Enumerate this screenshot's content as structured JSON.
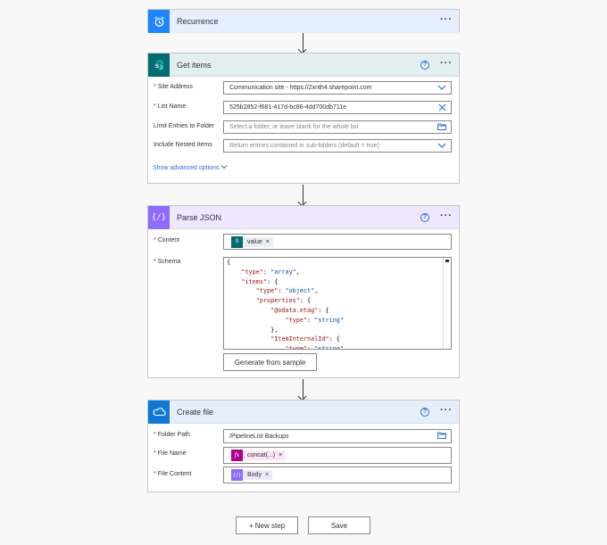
{
  "recurrence": {
    "title": "Recurrence"
  },
  "get_items": {
    "title": "Get items",
    "fields": [
      {
        "label": "Site Address",
        "required": true,
        "value": "Communication site - https://2xnth4.sharepoint.com"
      },
      {
        "label": "List Name",
        "required": true,
        "value": "525b2852-f681-417d-bc86-4dd700db711e"
      },
      {
        "label": "Limit Entries to Folder",
        "required": false,
        "placeholder": "Select a folder, or leave blank for the whole list"
      },
      {
        "label": "Include Nested Items",
        "required": false,
        "placeholder": "Return entries contained in sub-folders (default = true)"
      }
    ],
    "advanced_link": "Show advanced options"
  },
  "parse_json": {
    "title": "Parse JSON",
    "content_label": "Content",
    "content_token": "value",
    "schema_label": "Schema",
    "schema_lines": [
      "{",
      "    \"type\": \"array\",",
      "    \"items\": {",
      "        \"type\": \"object\",",
      "        \"properties\": {",
      "            \"@odata.etag\": {",
      "                \"type\": \"string\"",
      "            },",
      "            \"ItemInternalId\": {",
      "                \"type\": \"string\""
    ],
    "generate_button": "Generate from sample"
  },
  "create_file": {
    "title": "Create file",
    "folder_label": "Folder Path",
    "folder_value": "/PipelineList Backups",
    "filename_label": "File Name",
    "filename_token": "concat(...)",
    "content_label": "File Content",
    "content_token": "Body"
  },
  "footer": {
    "new_step": "+ New step",
    "save": "Save"
  },
  "colors": {
    "recurrence": "#1f85ff",
    "sharepoint": "#036c70",
    "parse_json": "#8c6cff",
    "onedrive": "#0f78d4",
    "accent": "#2b6fd6"
  }
}
